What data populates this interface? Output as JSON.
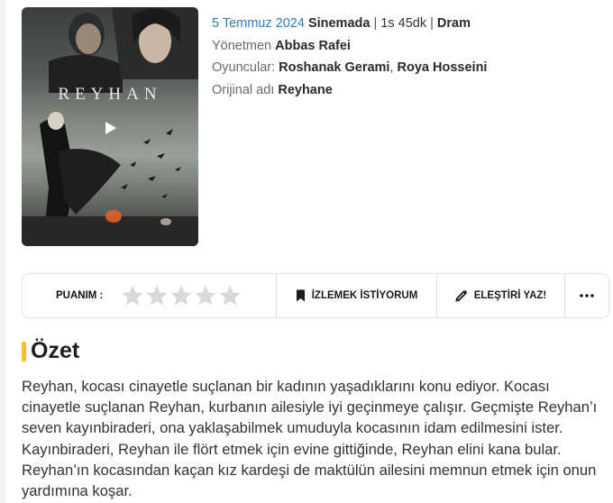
{
  "poster": {
    "title": "REYHAN",
    "play_icon": "play-icon"
  },
  "meta": {
    "date": "5 Temmuz 2024",
    "status": "Sinemada",
    "separator": "|",
    "duration": "1s 45dk",
    "genre": "Dram",
    "director_label": "Yönetmen",
    "director": "Abbas Rafei",
    "cast_label": "Oyuncular:",
    "cast": [
      "Roshanak Gerami",
      "Roya Hosseini"
    ],
    "cast_sep": ",",
    "original_label": "Orijinal adı",
    "original_name": "Reyhane"
  },
  "actions": {
    "rating_label": "PUANIM :",
    "rating_value": 0,
    "rating_max": 5,
    "watch_label": "İZLEMEK İSTİYORUM",
    "review_label": "ELEŞTİRİ YAZ!",
    "more_icon": "more-dots-icon"
  },
  "summary": {
    "title": "Özet",
    "text": "Reyhan, kocası cinayetle suçlanan bir kadının yaşadıklarını konu ediyor. Kocası cinayetle suçlanan Reyhan, kurbanın ailesiyle iyi geçinmeye çalışır. Geçmişte Reyhan’ı seven kayınbiraderi, ona yaklaşabilmek umuduyla kocasının idam edilmesini ister. Kayınbiraderi, Reyhan ile flört etmek için evine gittiğinde, Reyhan elini kana bular. Reyhan’ın kocasından kaçan kız kardeşi de maktülün ailesini memnun etmek için onun yardımına koşar."
  },
  "colors": {
    "accent": "#f6c21a",
    "date": "#2f7bbf",
    "star_empty": "#d9d9d9"
  }
}
